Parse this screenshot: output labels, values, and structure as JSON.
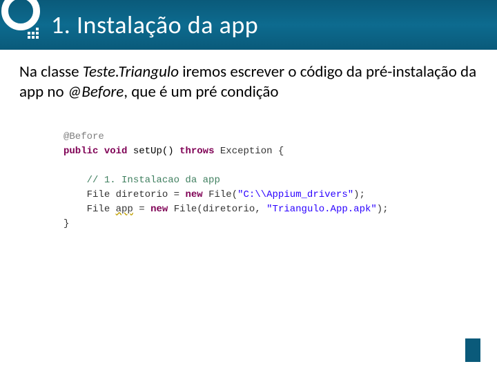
{
  "header": {
    "title": "1. Instalação da app"
  },
  "description": {
    "pre": "Na classe ",
    "class_name": "Teste.Triangulo",
    "mid": " iremos escrever  o código da pré-instalação da app no ",
    "annotation": "@Before",
    "post": ", que é um pré condição"
  },
  "code": {
    "annotation": "@Before",
    "kw_public": "public",
    "kw_void": "void",
    "method": "setUp()",
    "kw_throws": "throws",
    "exception": "Exception",
    "brace_open": "{",
    "comment": "// 1. Instalacao da app",
    "line1_type": "File",
    "line1_var": "diretorio",
    "line1_eq": " = ",
    "line1_new": "new",
    "line1_ctor": "File",
    "line1_open": "(",
    "line1_str": "\"C:\\\\Appium_drivers\"",
    "line1_close": ");",
    "line2_type": "File",
    "line2_var": "app",
    "line2_eq": " = ",
    "line2_new": "new",
    "line2_ctor": "File",
    "line2_open": "(",
    "line2_arg1": "diretorio",
    "line2_comma": ", ",
    "line2_str": "\"Triangulo.App.apk\"",
    "line2_close": ");",
    "brace_close": "}"
  }
}
